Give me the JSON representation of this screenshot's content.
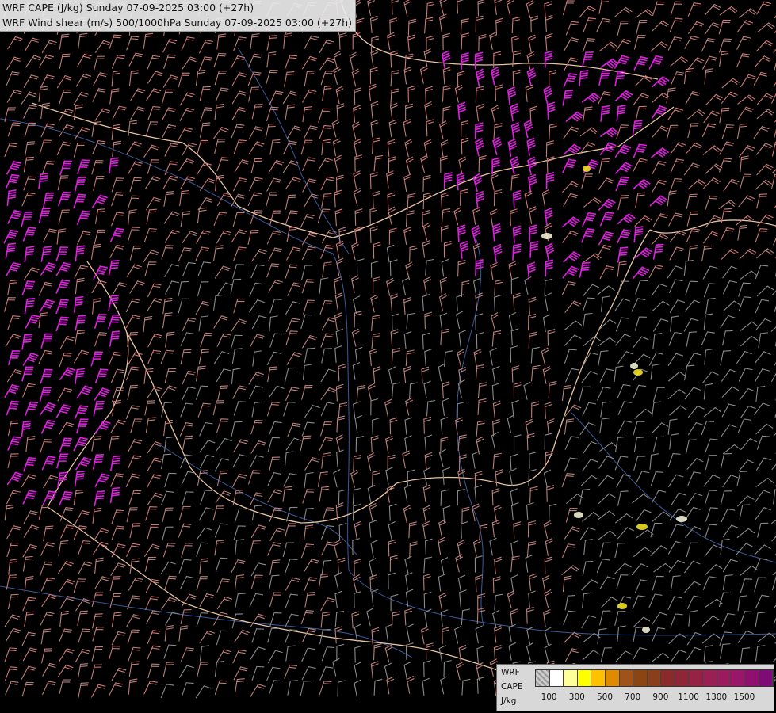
{
  "title": {
    "line1": "WRF CAPE (J/kg) Sunday 07-09-2025 03:00 (+27h)",
    "line2": "WRF Wind shear (m/s) 500/1000hPa Sunday 07-09-2025 03:00 (+27h)"
  },
  "legend": {
    "label_line1": "WRF",
    "label_line2": "CAPE",
    "label_line3": "J/kg",
    "colors": [
      "#e6e6e6",
      "#ffffff",
      "#ffff99",
      "#ffff00",
      "#ffc000",
      "#e08a00",
      "#a0521d",
      "#8b4513",
      "#8a3f1c",
      "#8b2a2a",
      "#8e2638",
      "#962244",
      "#9a1f52",
      "#9c1a5e",
      "#9a1668",
      "#901070",
      "#800a76"
    ],
    "ticks": [
      "100",
      "300",
      "500",
      "700",
      "900",
      "1100",
      "1300",
      "1500"
    ]
  },
  "map_colors": {
    "background": "#000000",
    "country_border": "#e8c4a0",
    "river": "#3a5a9a",
    "barb_weak": "#8a8a8a",
    "barb_mid": "#b9807c",
    "barb_strong": "#c87a78",
    "barb_extreme": "#e020e0",
    "barb_yellow": "#ffee22"
  }
}
